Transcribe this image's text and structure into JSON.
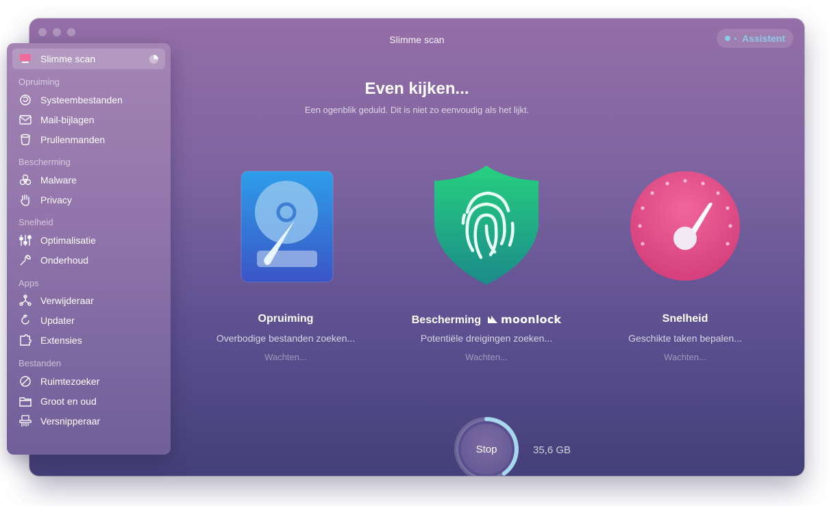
{
  "window": {
    "title": "Slimme scan",
    "assistant_label": "Assistent"
  },
  "sidebar": {
    "active": {
      "label": "Slimme scan",
      "icon": "monitor-icon"
    },
    "sections": [
      {
        "title": "Opruiming",
        "items": [
          {
            "label": "Systeembestanden",
            "icon": "system-junk-icon"
          },
          {
            "label": "Mail-bijlagen",
            "icon": "mail-icon"
          },
          {
            "label": "Prullenmanden",
            "icon": "trash-icon"
          }
        ]
      },
      {
        "title": "Bescherming",
        "items": [
          {
            "label": "Malware",
            "icon": "biohazard-icon"
          },
          {
            "label": "Privacy",
            "icon": "hand-icon"
          }
        ]
      },
      {
        "title": "Snelheid",
        "items": [
          {
            "label": "Optimalisatie",
            "icon": "sliders-icon"
          },
          {
            "label": "Onderhoud",
            "icon": "wrench-icon"
          }
        ]
      },
      {
        "title": "Apps",
        "items": [
          {
            "label": "Verwijderaar",
            "icon": "uninstaller-icon"
          },
          {
            "label": "Updater",
            "icon": "updater-icon"
          },
          {
            "label": "Extensies",
            "icon": "puzzle-icon"
          }
        ]
      },
      {
        "title": "Bestanden",
        "items": [
          {
            "label": "Ruimtezoeker",
            "icon": "space-lens-icon"
          },
          {
            "label": "Groot en oud",
            "icon": "folder-icon"
          },
          {
            "label": "Versnipperaar",
            "icon": "shredder-icon"
          }
        ]
      }
    ]
  },
  "main": {
    "title": "Even kijken...",
    "subtitle": "Een ogenblik geduld. Dit is niet zo eenvoudig als het lijkt.",
    "cards": [
      {
        "title": "Opruiming",
        "status": "Overbodige bestanden zoeken...",
        "state": "Wachten...",
        "icon": "hard-drive-icon"
      },
      {
        "title": "Bescherming",
        "brand": "moonlock",
        "status": "Potentiële dreigingen zoeken...",
        "state": "Wachten...",
        "icon": "fingerprint-shield-icon"
      },
      {
        "title": "Snelheid",
        "status": "Geschikte taken bepalen...",
        "state": "Wachten...",
        "icon": "speedometer-icon"
      }
    ]
  },
  "footer": {
    "stop_label": "Stop",
    "size": "35,6 GB",
    "progress": 0.4
  },
  "colors": {
    "accent": "#8fc7e6",
    "shield": "#22c48a",
    "gauge": "#e8508a",
    "drive": "#3a78d8"
  }
}
